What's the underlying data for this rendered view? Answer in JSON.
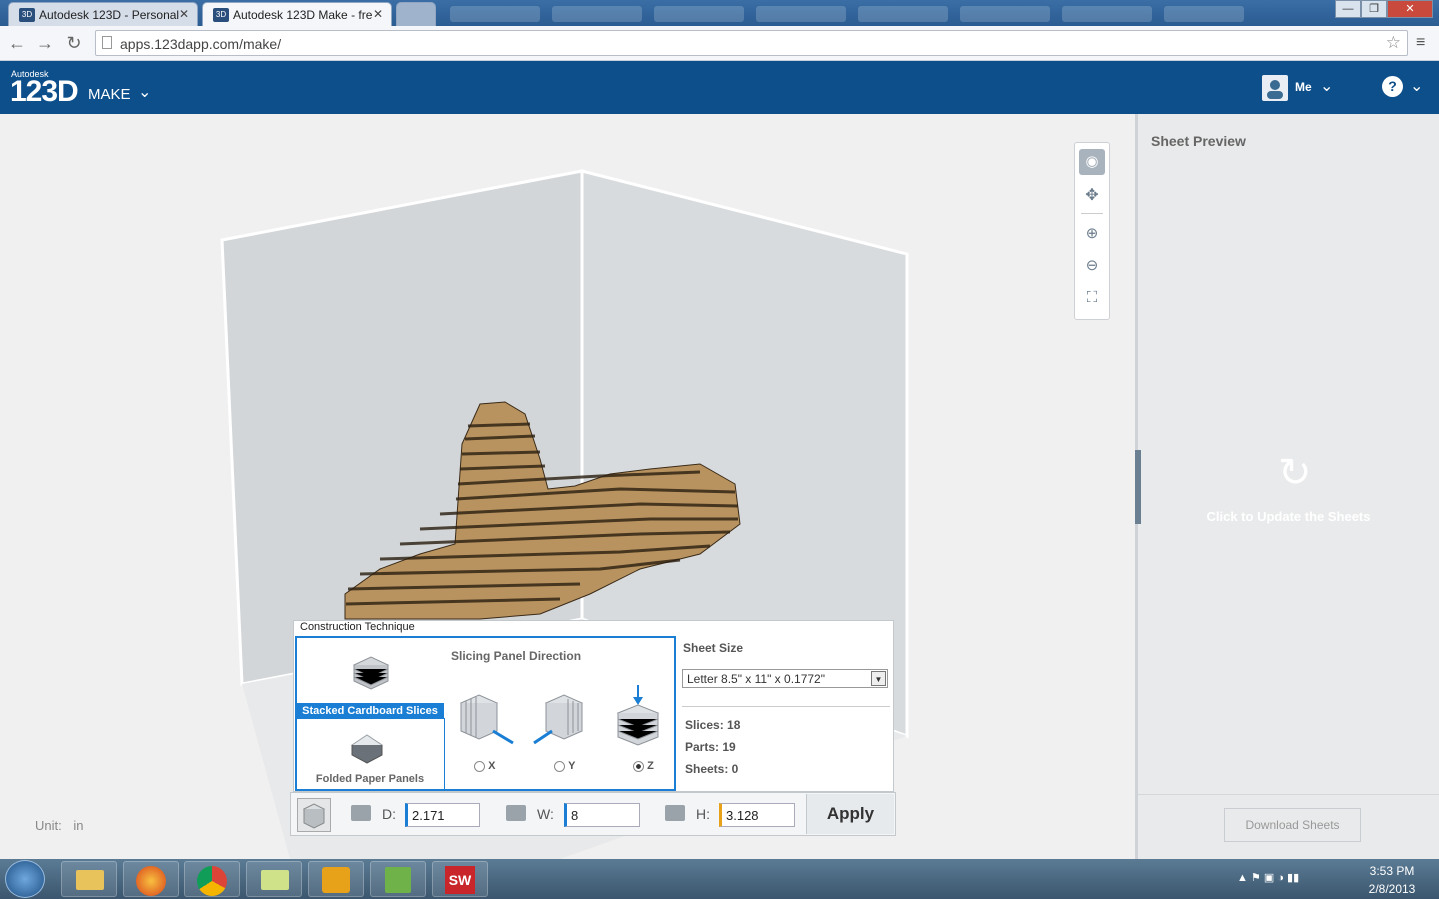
{
  "browser": {
    "tabs": [
      {
        "label": "Autodesk 123D - Personal",
        "active": false
      },
      {
        "label": "Autodesk 123D Make - fre",
        "active": true
      }
    ],
    "url": "apps.123dapp.com/make/"
  },
  "app": {
    "brand_small": "Autodesk",
    "brand_big": "123D",
    "product": "MAKE",
    "user_label": "Me",
    "help_label": "?"
  },
  "right_panel": {
    "title": "Sheet Preview",
    "update_label": "Click to Update the Sheets",
    "download_label": "Download Sheets"
  },
  "unit": {
    "label": "Unit:",
    "value": "in"
  },
  "construction": {
    "title": "Construction Technique",
    "techniques": [
      {
        "label": "Stacked Cardboard Slices",
        "selected": true
      },
      {
        "label": "Folded Paper Panels",
        "selected": false
      }
    ],
    "slicing_title": "Slicing Panel Direction",
    "directions": [
      {
        "label": "X",
        "selected": false
      },
      {
        "label": "Y",
        "selected": false
      },
      {
        "label": "Z",
        "selected": true
      }
    ],
    "sheet_size_title": "Sheet Size",
    "sheet_size_value": "Letter 8.5\" x 11\" x 0.1772\"",
    "stats": {
      "slices": "Slices: 18",
      "parts": "Parts: 19",
      "sheets": "Sheets: 0"
    }
  },
  "dimensions": {
    "d_label": "D:",
    "d_value": "2.171",
    "w_label": "W:",
    "w_value": "8",
    "h_label": "H:",
    "h_value": "3.128",
    "apply_label": "Apply"
  },
  "taskbar": {
    "time": "3:53 PM",
    "date": "2/8/2013"
  },
  "colors": {
    "header": "#0d4f8b",
    "accent": "#1a7fd4",
    "cardboard": "#b8935f"
  }
}
